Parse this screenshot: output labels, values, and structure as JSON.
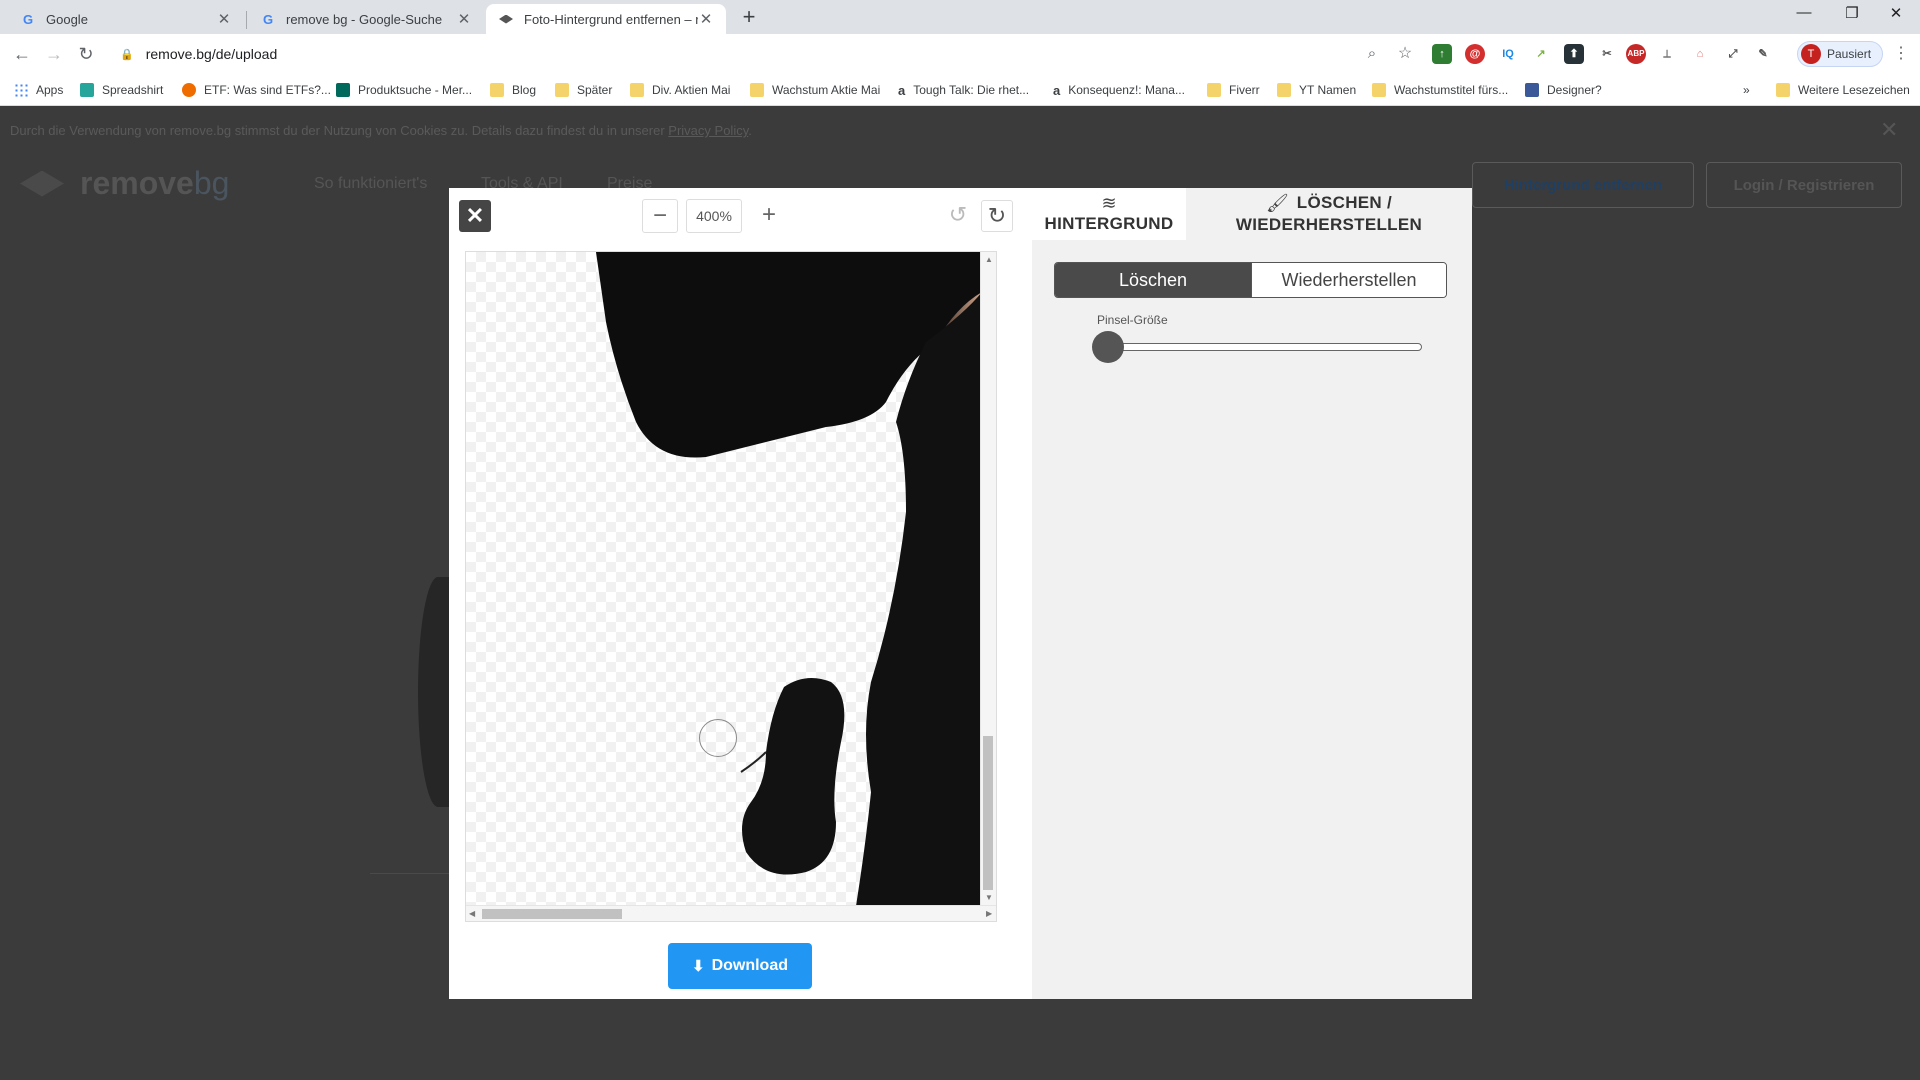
{
  "browser": {
    "tabs": [
      {
        "title": "Google",
        "icon": "google-icon"
      },
      {
        "title": "remove bg - Google-Suche",
        "icon": "google-icon"
      },
      {
        "title": "Foto-Hintergrund entfernen – re",
        "icon": "removebg-icon"
      }
    ],
    "url": "remove.bg/de/upload",
    "profile": {
      "initial": "T",
      "label": "Pausiert"
    },
    "bookmarks": [
      "Apps",
      "Spreadshirt",
      "ETF: Was sind ETFs?...",
      "Produktsuche - Mer...",
      "Blog",
      "Später",
      "Div. Aktien Mai",
      "Wachstum Aktie Mai",
      "Tough Talk: Die rhet...",
      "Konsequenz!: Mana...",
      "Fiverr",
      "YT Namen",
      "Wachstumstitel fürs...",
      "Designer?"
    ],
    "bookmarks_more": "»",
    "other_bookmarks": "Weitere Lesezeichen"
  },
  "page": {
    "cookie_text": "Durch die Verwendung von remove.bg stimmst du der Nutzung von Cookies zu. Details dazu findest du in unserer ",
    "cookie_link": "Privacy Policy",
    "cookie_end": ".",
    "logo_main": "remove",
    "logo_accent": "bg",
    "nav": [
      "So funktioniert's",
      "Tools & API",
      "Preise"
    ],
    "cta_button": "Hintergrund entfernen",
    "login_button": "Login / Registrieren"
  },
  "editor": {
    "zoom": "400%",
    "zoom_minus": "−",
    "zoom_plus": "+",
    "download_label": "Download",
    "tabs": {
      "background": "HINTERGRUND",
      "erase_restore_line1": "LÖSCHEN /",
      "erase_restore_line2": "WIEDERHERSTELLEN"
    },
    "mode_erase": "Löschen",
    "mode_restore": "Wiederherstellen",
    "brush_size_label": "Pinsel-Größe",
    "brush_size": 0.0
  },
  "colors": {
    "download_blue": "#2196f3",
    "active_mode": "#4a4a4a"
  }
}
